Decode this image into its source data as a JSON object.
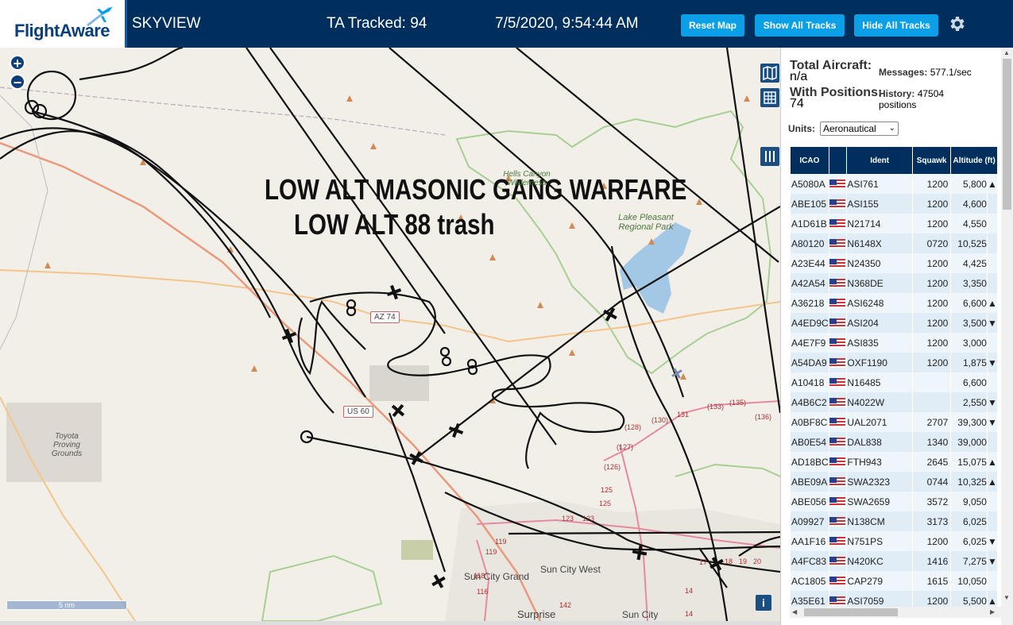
{
  "header": {
    "logo": "FlightAware",
    "app_title": "SKYVIEW",
    "ta_tracked": "TA Tracked: 94",
    "datetime": "7/5/2020, 9:54:44 AM",
    "buttons": {
      "reset_map": "Reset Map",
      "show_all_tracks": "Show All Tracks",
      "hide_all_tracks": "Hide All Tracks"
    },
    "gear_icon": "gear-icon"
  },
  "map": {
    "overlay_line1": "LOW ALT MASONIC GANG WARFARE",
    "overlay_line2": "LOW ALT 88 trash",
    "places": {
      "lake_pleasant": "Lake Pleasant Regional Park",
      "hells_canyon": "Hells Canyon Wilderness",
      "toyota": "Toyota Proving Grounds",
      "sun_city_grand": "Sun City Grand",
      "sun_city_west": "Sun City West",
      "surprise": "Surprise",
      "sun_city": "Sun City"
    },
    "roads": {
      "az74": "AZ 74",
      "us60": "US 60"
    },
    "road_numbers": [
      "131",
      "(133)",
      "(135)",
      "(136)",
      "(130)",
      "(128)",
      "(127)",
      "(126)",
      "125",
      "125",
      "123",
      "123",
      "119",
      "119",
      "118",
      "116",
      "142",
      "14",
      "14",
      "17",
      "18",
      "19",
      "20"
    ],
    "scale": "5 nm",
    "info": "i",
    "zoom_in": "+",
    "zoom_out": "−"
  },
  "sidebar": {
    "total_aircraft_label": "Total Aircraft:",
    "total_aircraft_value": "n/a",
    "with_positions_label": "With Positions:",
    "with_positions_value": "74",
    "messages_label": "Messages:",
    "messages_value": "577.1/sec",
    "history_label": "History:",
    "history_value": "47504 positions",
    "units_label": "Units:",
    "units_value": "Aeronautical",
    "columns": [
      "ICAO",
      "",
      "Ident",
      "Squawk",
      "Altitude (ft)"
    ],
    "rows": [
      {
        "icao": "A5080A",
        "ident": "ASI761",
        "squawk": "1200",
        "alt": "5,800",
        "arrow": "▲"
      },
      {
        "icao": "ABE105",
        "ident": "ASI155",
        "squawk": "1200",
        "alt": "4,600",
        "arrow": ""
      },
      {
        "icao": "A1D61B",
        "ident": "N21714",
        "squawk": "1200",
        "alt": "4,550",
        "arrow": ""
      },
      {
        "icao": "A80120",
        "ident": "N6148X",
        "squawk": "0720",
        "alt": "10,525",
        "arrow": ""
      },
      {
        "icao": "A23E44",
        "ident": "N24350",
        "squawk": "1200",
        "alt": "4,425",
        "arrow": ""
      },
      {
        "icao": "A42A54",
        "ident": "N368DE",
        "squawk": "1200",
        "alt": "3,350",
        "arrow": ""
      },
      {
        "icao": "A36218",
        "ident": "ASI6248",
        "squawk": "1200",
        "alt": "6,600",
        "arrow": "▲"
      },
      {
        "icao": "A4ED9C",
        "ident": "ASI204",
        "squawk": "1200",
        "alt": "3,500",
        "arrow": "▼"
      },
      {
        "icao": "A4E7F9",
        "ident": "ASI835",
        "squawk": "1200",
        "alt": "3,000",
        "arrow": ""
      },
      {
        "icao": "A54DA9",
        "ident": "OXF1190",
        "squawk": "1200",
        "alt": "1,875",
        "arrow": "▼"
      },
      {
        "icao": "A10418",
        "ident": "N16485",
        "squawk": "",
        "alt": "6,600",
        "arrow": ""
      },
      {
        "icao": "A4B6C2",
        "ident": "N4022W",
        "squawk": "",
        "alt": "2,550",
        "arrow": "▼"
      },
      {
        "icao": "A0BF8C",
        "ident": "UAL2071",
        "squawk": "2707",
        "alt": "39,300",
        "arrow": "▼"
      },
      {
        "icao": "AB0E54",
        "ident": "DAL838",
        "squawk": "1340",
        "alt": "39,000",
        "arrow": ""
      },
      {
        "icao": "AD18BC",
        "ident": "FTH943",
        "squawk": "2645",
        "alt": "15,075",
        "arrow": "▲"
      },
      {
        "icao": "ABE09A",
        "ident": "SWA2323",
        "squawk": "0744",
        "alt": "10,325",
        "arrow": "▲"
      },
      {
        "icao": "ABE056",
        "ident": "SWA2659",
        "squawk": "3572",
        "alt": "9,050",
        "arrow": ""
      },
      {
        "icao": "A09927",
        "ident": "N138CM",
        "squawk": "3173",
        "alt": "6,025",
        "arrow": ""
      },
      {
        "icao": "AA1F16",
        "ident": "N751PS",
        "squawk": "1200",
        "alt": "6,025",
        "arrow": "▼"
      },
      {
        "icao": "A4FC83",
        "ident": "N420KC",
        "squawk": "1416",
        "alt": "7,275",
        "arrow": "▼"
      },
      {
        "icao": "AC1805",
        "ident": "CAP279",
        "squawk": "1615",
        "alt": "10,050",
        "arrow": ""
      },
      {
        "icao": "A35E61",
        "ident": "ASI7059",
        "squawk": "1200",
        "alt": "5,500",
        "arrow": "▲"
      }
    ]
  }
}
